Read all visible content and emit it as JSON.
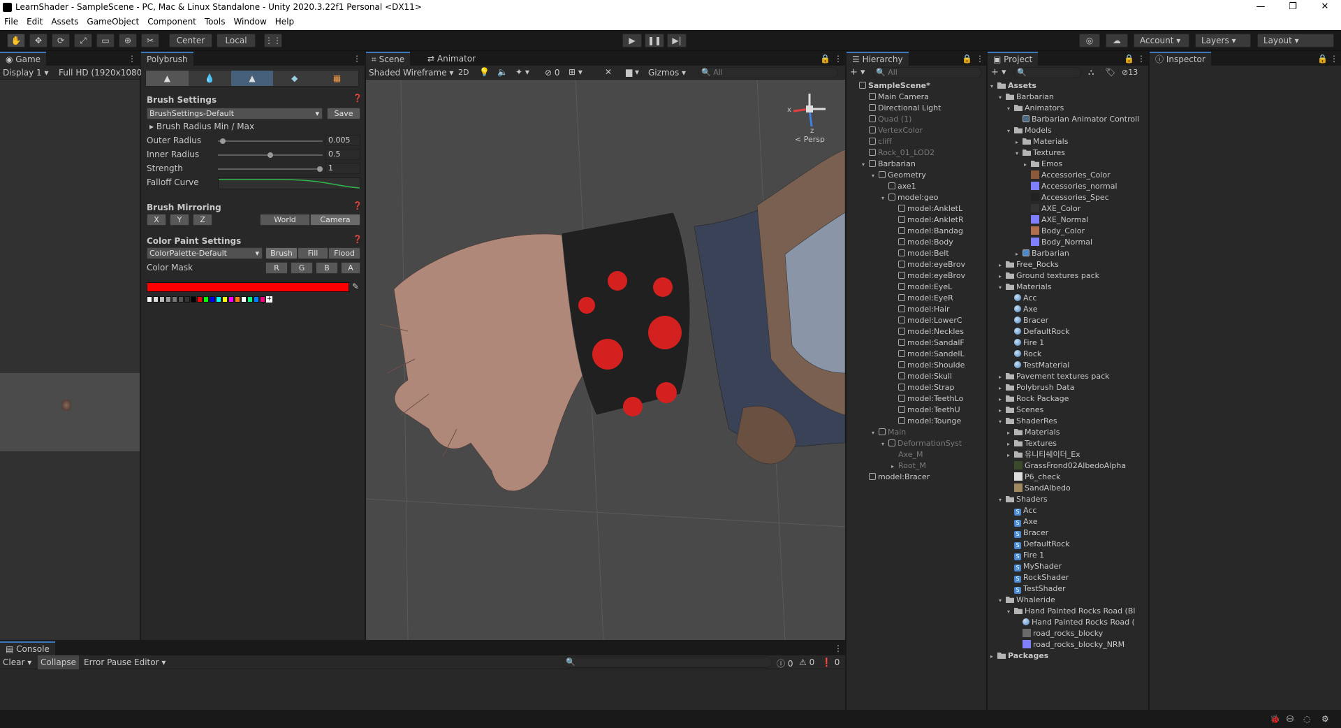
{
  "window": {
    "title": "LearnShader - SampleScene - PC, Mac & Linux Standalone - Unity 2020.3.22f1 Personal <DX11>"
  },
  "menu": [
    "File",
    "Edit",
    "Assets",
    "GameObject",
    "Component",
    "Tools",
    "Window",
    "Help"
  ],
  "toolbar": {
    "pivot": "Center",
    "space": "Local",
    "account": "Account",
    "layers": "Layers",
    "layout": "Layout"
  },
  "game": {
    "tab": "Game",
    "display": "Display 1",
    "resolution": "Full HD (1920x1080)"
  },
  "polybrush": {
    "tab": "Polybrush",
    "brush_settings": "Brush Settings",
    "preset": "BrushSettings-Default",
    "save": "Save",
    "radius_minmax": "Brush Radius Min / Max",
    "outer_label": "Outer Radius",
    "outer_value": "0.005",
    "outer_level": 0.02,
    "inner_label": "Inner Radius",
    "inner_value": "0.5",
    "inner_level": 0.5,
    "strength_label": "Strength",
    "strength_value": "1",
    "strength_level": 1.0,
    "falloff_label": "Falloff Curve",
    "mirroring": "Brush Mirroring",
    "mirror_x": "X",
    "mirror_y": "Y",
    "mirror_z": "Z",
    "world": "World",
    "camera": "Camera",
    "color_paint": "Color Paint Settings",
    "palette": "ColorPalette-Default",
    "brush": "Brush",
    "fill": "Fill",
    "flood": "Flood",
    "color_mask": "Color Mask",
    "mask_r": "R",
    "mask_g": "G",
    "mask_b": "B",
    "mask_a": "A",
    "current_color": "#ff0000",
    "swatches": [
      "#ffffff",
      "#dddddd",
      "#bbbbbb",
      "#999999",
      "#777777",
      "#555555",
      "#333333",
      "#000000",
      "#ff0000",
      "#00ff00",
      "#0000ff",
      "#00ffff",
      "#ffff00",
      "#ff00ff",
      "#ff8000",
      "#ffffff",
      "#00ff80",
      "#0080ff",
      "#ff0080"
    ]
  },
  "scene": {
    "tab": "Scene",
    "tab2": "Animator",
    "shading": "Shaded Wireframe",
    "mode2d": "2D",
    "hidden_count": "0",
    "gizmos": "Gizmos",
    "search_placeholder": "All",
    "persp": "< Persp",
    "axis_x": "x",
    "axis_z": "z"
  },
  "hierarchy": {
    "tab": "Hierarchy",
    "search_placeholder": "All",
    "items": [
      {
        "label": "SampleScene*",
        "depth": 0,
        "kind": "scene",
        "dim": false
      },
      {
        "label": "Main Camera",
        "depth": 1,
        "kind": "go",
        "dim": false
      },
      {
        "label": "Directional Light",
        "depth": 1,
        "kind": "go",
        "dim": false
      },
      {
        "label": "Quad (1)",
        "depth": 1,
        "kind": "go",
        "dim": true
      },
      {
        "label": "VertexColor",
        "depth": 1,
        "kind": "go",
        "dim": true
      },
      {
        "label": "cliff",
        "depth": 1,
        "kind": "go",
        "dim": true
      },
      {
        "label": "Rock_01_LOD2",
        "depth": 1,
        "kind": "go",
        "dim": true
      },
      {
        "label": "Barbarian",
        "depth": 1,
        "kind": "go",
        "dim": false,
        "open": true
      },
      {
        "label": "Geometry",
        "depth": 2,
        "kind": "go",
        "dim": false,
        "open": true
      },
      {
        "label": "axe1",
        "depth": 3,
        "kind": "go",
        "dim": false
      },
      {
        "label": "model:geo",
        "depth": 3,
        "kind": "go",
        "dim": false,
        "open": true
      },
      {
        "label": "model:AnkletL",
        "depth": 4,
        "kind": "go",
        "dim": false
      },
      {
        "label": "model:AnkletR",
        "depth": 4,
        "kind": "go",
        "dim": false
      },
      {
        "label": "model:Bandag",
        "depth": 4,
        "kind": "go",
        "dim": false
      },
      {
        "label": "model:Body",
        "depth": 4,
        "kind": "go",
        "dim": false
      },
      {
        "label": "model:Belt",
        "depth": 4,
        "kind": "go",
        "dim": false
      },
      {
        "label": "model:eyeBrov",
        "depth": 4,
        "kind": "go",
        "dim": false
      },
      {
        "label": "model:eyeBrov",
        "depth": 4,
        "kind": "go",
        "dim": false
      },
      {
        "label": "model:EyeL",
        "depth": 4,
        "kind": "go",
        "dim": false
      },
      {
        "label": "model:EyeR",
        "depth": 4,
        "kind": "go",
        "dim": false
      },
      {
        "label": "model:Hair",
        "depth": 4,
        "kind": "go",
        "dim": false
      },
      {
        "label": "model:LowerC",
        "depth": 4,
        "kind": "go",
        "dim": false
      },
      {
        "label": "model:Neckles",
        "depth": 4,
        "kind": "go",
        "dim": false
      },
      {
        "label": "model:SandalF",
        "depth": 4,
        "kind": "go",
        "dim": false
      },
      {
        "label": "model:SandelL",
        "depth": 4,
        "kind": "go",
        "dim": false
      },
      {
        "label": "model:Shoulde",
        "depth": 4,
        "kind": "go",
        "dim": false
      },
      {
        "label": "model:Skull",
        "depth": 4,
        "kind": "go",
        "dim": false
      },
      {
        "label": "model:Strap",
        "depth": 4,
        "kind": "go",
        "dim": false
      },
      {
        "label": "model:TeethLo",
        "depth": 4,
        "kind": "go",
        "dim": false
      },
      {
        "label": "model:TeethU",
        "depth": 4,
        "kind": "go",
        "dim": false
      },
      {
        "label": "model:Tounge",
        "depth": 4,
        "kind": "go",
        "dim": false
      },
      {
        "label": "Main",
        "depth": 2,
        "kind": "go",
        "dim": true,
        "open": true
      },
      {
        "label": "DeformationSyst",
        "depth": 3,
        "kind": "go",
        "dim": true,
        "open": true
      },
      {
        "label": "Axe_M",
        "depth": 4,
        "kind": "none",
        "dim": true
      },
      {
        "label": "Root_M",
        "depth": 4,
        "kind": "none",
        "dim": true,
        "closed": true
      },
      {
        "label": "model:Bracer",
        "depth": 1,
        "kind": "go",
        "dim": false
      }
    ]
  },
  "project": {
    "tab": "Project",
    "count": "13",
    "items": [
      {
        "label": "Assets",
        "depth": 0,
        "kind": "folder",
        "bold": true,
        "open": true
      },
      {
        "label": "Barbarian",
        "depth": 1,
        "kind": "folder",
        "open": true
      },
      {
        "label": "Animators",
        "depth": 2,
        "kind": "folder",
        "open": true
      },
      {
        "label": "Barbarian Animator Controll",
        "depth": 3,
        "kind": "anim"
      },
      {
        "label": "Models",
        "depth": 2,
        "kind": "folder",
        "open": true
      },
      {
        "label": "Materials",
        "depth": 3,
        "kind": "folder",
        "closed": true
      },
      {
        "label": "Textures",
        "depth": 3,
        "kind": "folder",
        "open": true
      },
      {
        "label": "Emos",
        "depth": 4,
        "kind": "folder",
        "closed": true
      },
      {
        "label": "Accessories_Color",
        "depth": 4,
        "kind": "tex",
        "color": "#8a5a3a"
      },
      {
        "label": "Accessories_normal",
        "depth": 4,
        "kind": "tex",
        "color": "#8080ff"
      },
      {
        "label": "Accessories_Spec",
        "depth": 4,
        "kind": "tex",
        "color": "#222222"
      },
      {
        "label": "AXE_Color",
        "depth": 4,
        "kind": "tex",
        "color": "#333333"
      },
      {
        "label": "AXE_Normal",
        "depth": 4,
        "kind": "tex",
        "color": "#8080ff"
      },
      {
        "label": "Body_Color",
        "depth": 4,
        "kind": "tex",
        "color": "#b07050"
      },
      {
        "label": "Body_Normal",
        "depth": 4,
        "kind": "tex",
        "color": "#8080ff"
      },
      {
        "label": "Barbarian",
        "depth": 3,
        "kind": "prefab",
        "closed": true
      },
      {
        "label": "Free_Rocks",
        "depth": 1,
        "kind": "folder",
        "closed": true
      },
      {
        "label": "Ground textures pack",
        "depth": 1,
        "kind": "folder",
        "closed": true
      },
      {
        "label": "Materials",
        "depth": 1,
        "kind": "folder",
        "open": true
      },
      {
        "label": "Acc",
        "depth": 2,
        "kind": "mat"
      },
      {
        "label": "Axe",
        "depth": 2,
        "kind": "mat"
      },
      {
        "label": "Bracer",
        "depth": 2,
        "kind": "mat"
      },
      {
        "label": "DefaultRock",
        "depth": 2,
        "kind": "mat"
      },
      {
        "label": "Fire 1",
        "depth": 2,
        "kind": "mat"
      },
      {
        "label": "Rock",
        "depth": 2,
        "kind": "mat"
      },
      {
        "label": "TestMaterial",
        "depth": 2,
        "kind": "mat"
      },
      {
        "label": "Pavement textures pack",
        "depth": 1,
        "kind": "folder",
        "closed": true
      },
      {
        "label": "Polybrush Data",
        "depth": 1,
        "kind": "folder",
        "closed": true
      },
      {
        "label": "Rock Package",
        "depth": 1,
        "kind": "folder",
        "closed": true
      },
      {
        "label": "Scenes",
        "depth": 1,
        "kind": "folder",
        "closed": true
      },
      {
        "label": "ShaderRes",
        "depth": 1,
        "kind": "folder",
        "open": true
      },
      {
        "label": "Materials",
        "depth": 2,
        "kind": "folder",
        "closed": true
      },
      {
        "label": "Textures",
        "depth": 2,
        "kind": "folder",
        "closed": true
      },
      {
        "label": "유니티쉐이더_Ex",
        "depth": 2,
        "kind": "folder",
        "closed": true
      },
      {
        "label": "GrassFrond02AlbedoAlpha",
        "depth": 2,
        "kind": "tex",
        "color": "#3a4a2a"
      },
      {
        "label": "P6_check",
        "depth": 2,
        "kind": "tex",
        "color": "#dddddd"
      },
      {
        "label": "SandAlbedo",
        "depth": 2,
        "kind": "tex",
        "color": "#a08860"
      },
      {
        "label": "Shaders",
        "depth": 1,
        "kind": "folder",
        "open": true
      },
      {
        "label": "Acc",
        "depth": 2,
        "kind": "shader"
      },
      {
        "label": "Axe",
        "depth": 2,
        "kind": "shader"
      },
      {
        "label": "Bracer",
        "depth": 2,
        "kind": "shader"
      },
      {
        "label": "DefaultRock",
        "depth": 2,
        "kind": "shader"
      },
      {
        "label": "Fire 1",
        "depth": 2,
        "kind": "shader"
      },
      {
        "label": "MyShader",
        "depth": 2,
        "kind": "shader"
      },
      {
        "label": "RockShader",
        "depth": 2,
        "kind": "shader"
      },
      {
        "label": "TestShader",
        "depth": 2,
        "kind": "shader"
      },
      {
        "label": "Whaleride",
        "depth": 1,
        "kind": "folder",
        "open": true
      },
      {
        "label": "Hand Painted Rocks Road (Bl",
        "depth": 2,
        "kind": "folder",
        "open": true
      },
      {
        "label": "Hand Painted Rocks Road (",
        "depth": 3,
        "kind": "mat"
      },
      {
        "label": "road_rocks_blocky",
        "depth": 3,
        "kind": "tex",
        "color": "#6a6a6a"
      },
      {
        "label": "road_rocks_blocky_NRM",
        "depth": 3,
        "kind": "tex",
        "color": "#8080ff"
      },
      {
        "label": "Packages",
        "depth": 0,
        "kind": "folder",
        "bold": true,
        "closed": true
      }
    ]
  },
  "inspector": {
    "tab": "Inspector"
  },
  "console": {
    "tab": "Console",
    "clear": "Clear",
    "collapse": "Collapse",
    "error_pause": "Error Pause",
    "editor": "Editor",
    "count_info": "0",
    "count_warn": "0",
    "count_error": "0"
  }
}
